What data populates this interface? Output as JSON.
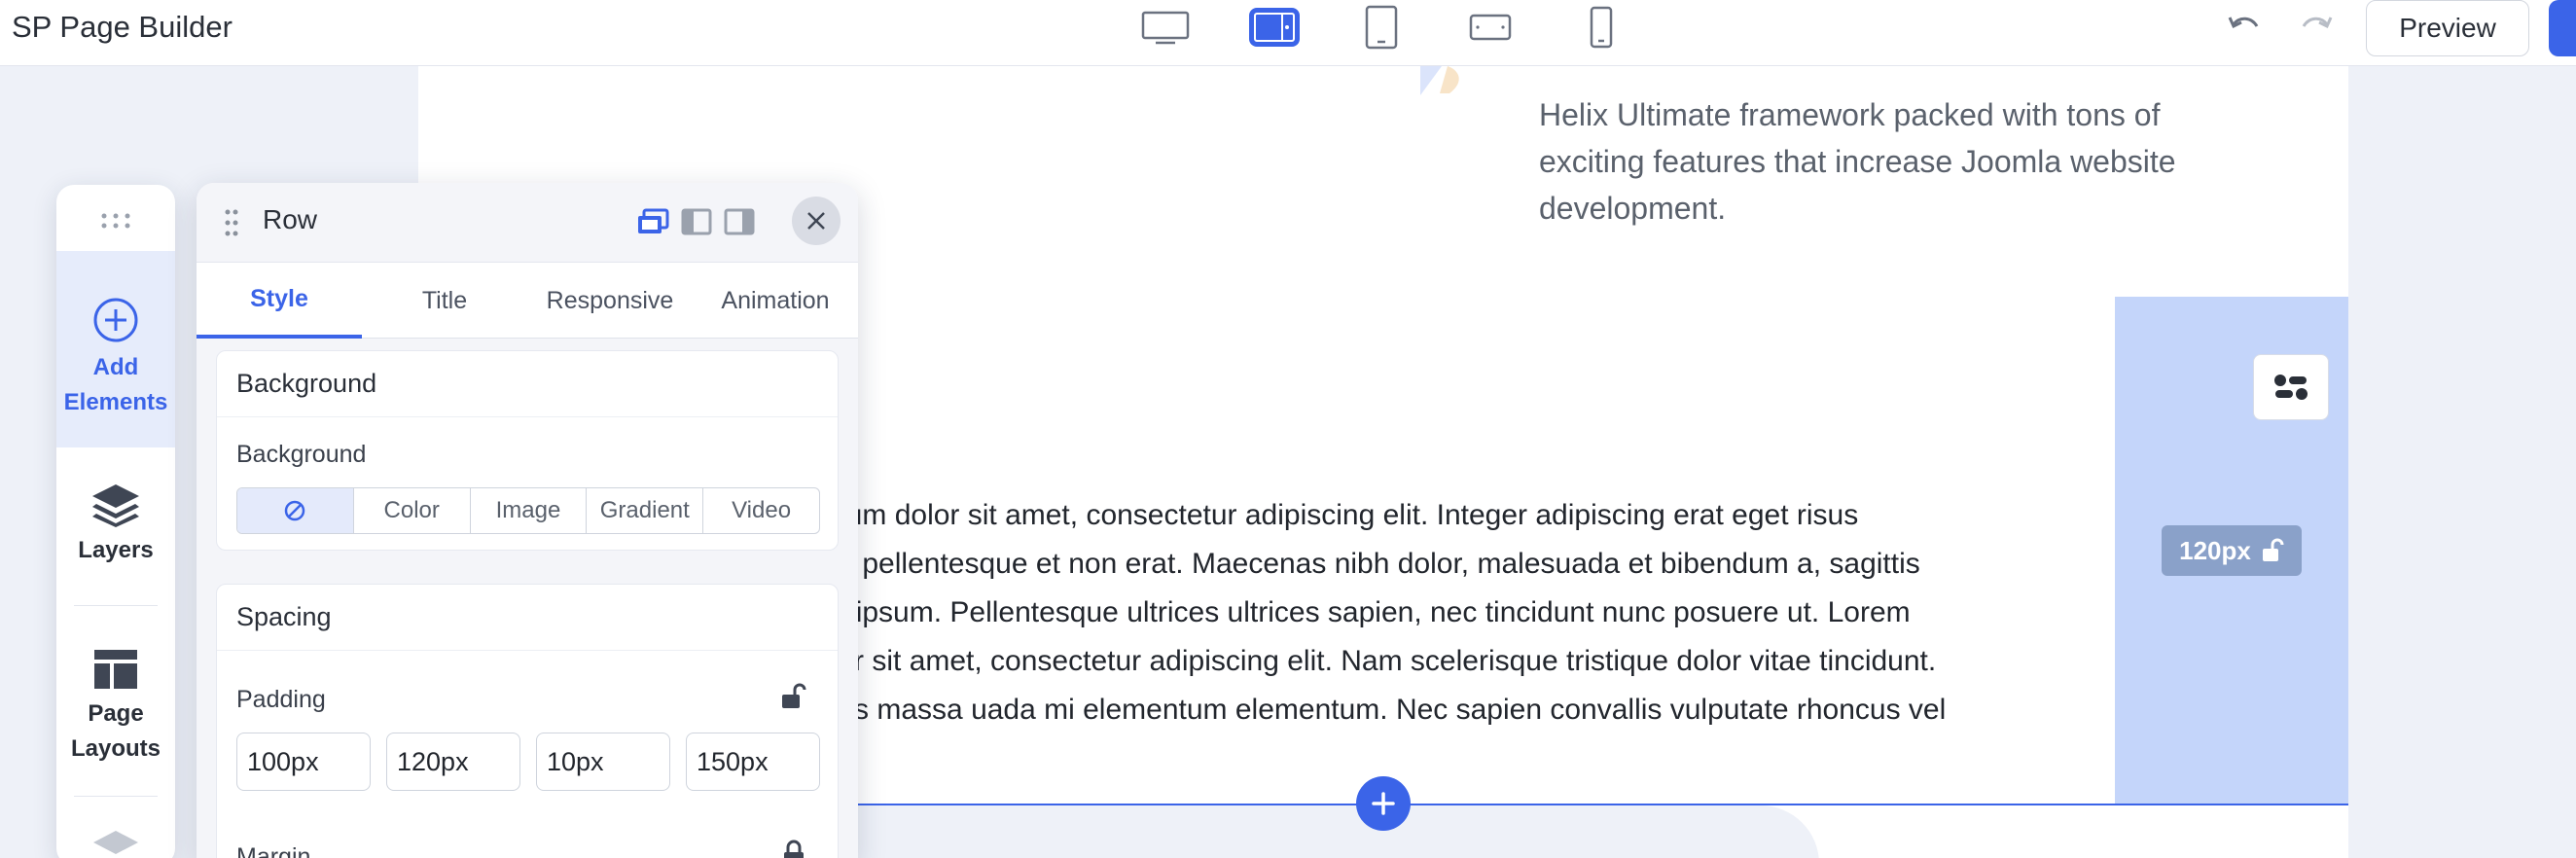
{
  "app": {
    "title": "SP Page Builder"
  },
  "toolbar": {
    "devices": [
      {
        "name": "desktop-icon",
        "active": false
      },
      {
        "name": "laptop-icon",
        "active": true
      },
      {
        "name": "tablet-icon",
        "active": false
      },
      {
        "name": "tablet-landscape-icon",
        "active": false
      },
      {
        "name": "mobile-icon",
        "active": false
      }
    ],
    "undo_icon": "undo-icon",
    "redo_icon": "redo-icon",
    "preview_label": "Preview"
  },
  "colors": {
    "accent": "#3b64e8",
    "column_highlight": "#c4d5fa",
    "badge": "#8aa1c9"
  },
  "side_toolbar": {
    "items": [
      {
        "label_line1": "Add",
        "label_line2": "Elements",
        "icon": "plus-circle-icon",
        "active": true
      },
      {
        "label_line1": "Layers",
        "label_line2": "",
        "icon": "layers-icon",
        "active": false
      },
      {
        "label_line1": "Page",
        "label_line2": "Layouts",
        "icon": "page-layout-icon",
        "active": false
      }
    ]
  },
  "panel": {
    "title": "Row",
    "tabs": [
      {
        "label": "Style",
        "active": true
      },
      {
        "label": "Title",
        "active": false
      },
      {
        "label": "Responsive",
        "active": false
      },
      {
        "label": "Animation",
        "active": false
      }
    ],
    "background_section": {
      "header": "Background",
      "field_label": "Background",
      "options": [
        "Color",
        "Image",
        "Gradient",
        "Video"
      ],
      "none_icon": "none-icon"
    },
    "spacing_section": {
      "header": "Spacing",
      "padding_label": "Padding",
      "padding_values": [
        "100px",
        "120px",
        "10px",
        "150px"
      ],
      "margin_label": "Margin"
    }
  },
  "canvas": {
    "feature_text": "Helix Ultimate framework packed with tons of exciting features that increase Joomla website development.",
    "paragraph_lines": [
      "psum dolor sit amet, consectetur adipiscing elit. Integer adipiscing erat eget risus",
      "din pellentesque et non erat. Maecenas nibh dolor, malesuada et bibendum a, sagittis",
      "an ipsum. Pellentesque ultrices ultrices sapien, nec tincidunt nunc posuere ut. Lorem",
      "olor sit amet, consectetur adipiscing elit. Nam scelerisque tristique dolor vitae tincidunt.",
      "quis massa uada mi elementum elementum. Nec sapien convallis vulputate rhoncus vel"
    ],
    "column_badge": "120px"
  }
}
